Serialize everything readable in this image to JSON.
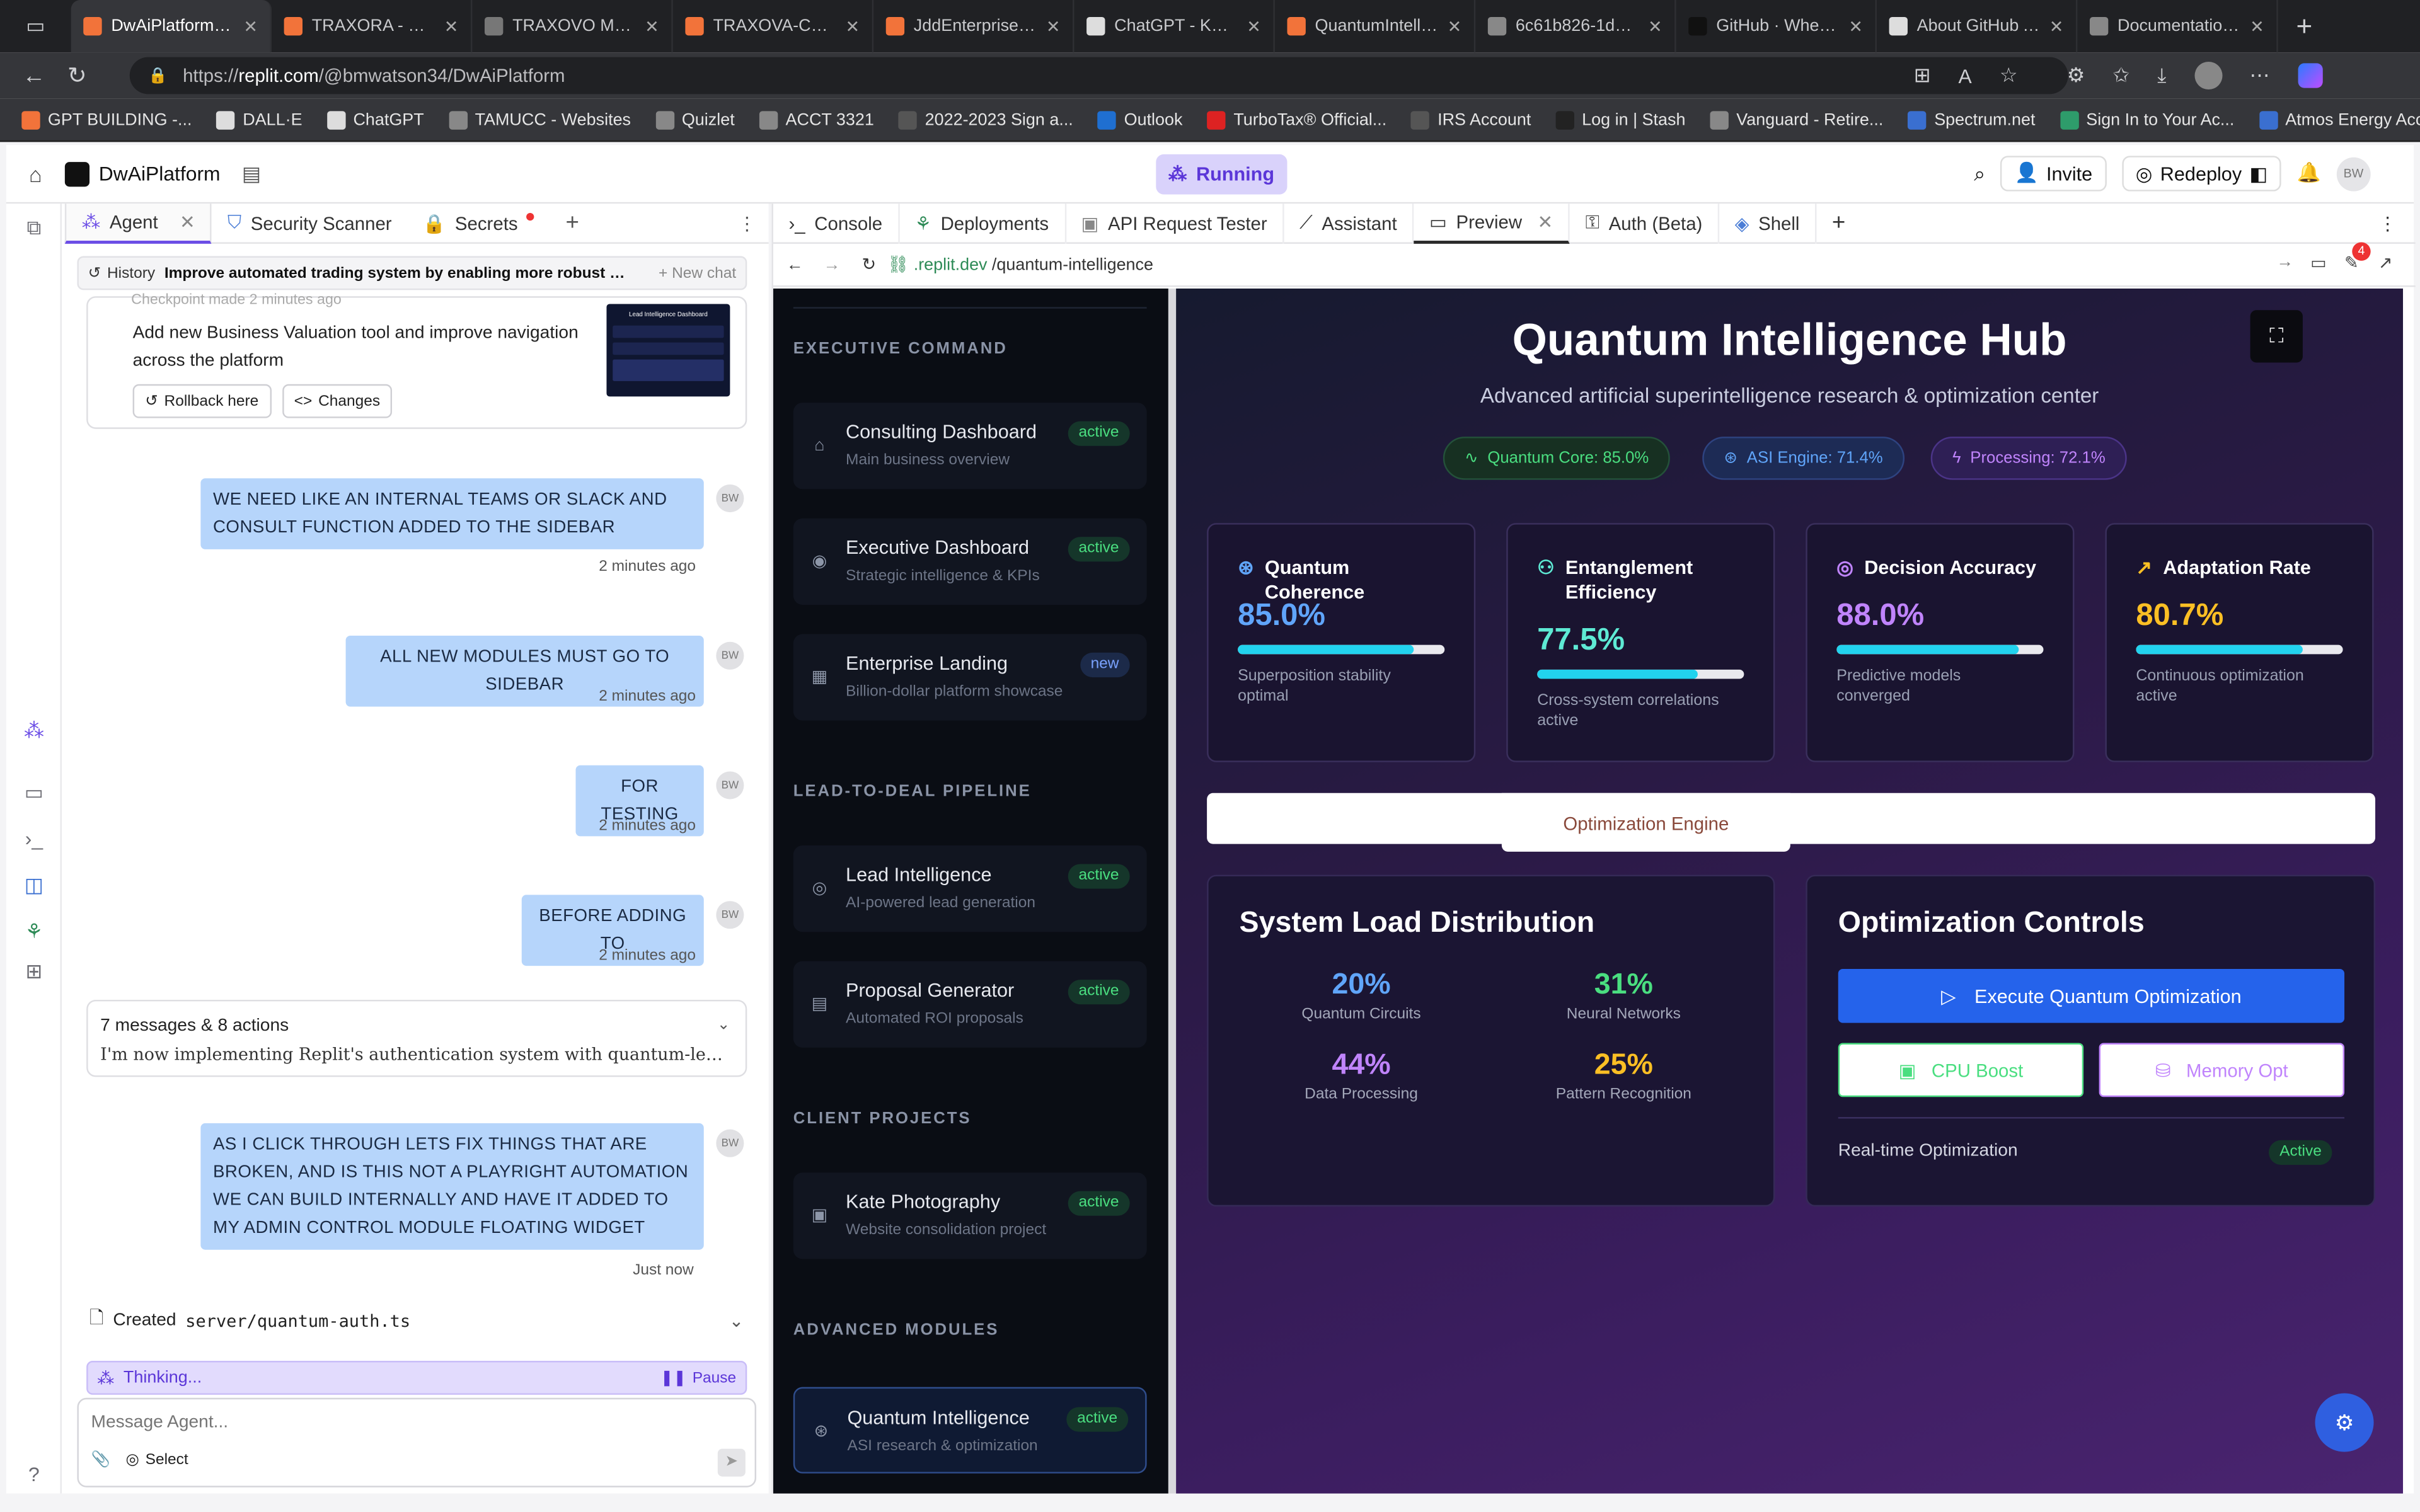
{
  "browser": {
    "tabs": [
      {
        "label": "DwAiPlatform - Re",
        "active": true
      },
      {
        "label": "TRAXORA - Replit"
      },
      {
        "label": "TRAXOVO Master"
      },
      {
        "label": "TRAXOVA-COMPL"
      },
      {
        "label": "JddEnterprisesAu"
      },
      {
        "label": "ChatGPT - Kaizen"
      },
      {
        "label": "QuantumIntelliger"
      },
      {
        "label": "6c61b826-1d0e-4"
      },
      {
        "label": "GitHub · Where sc"
      },
      {
        "label": "About GitHub Adv"
      },
      {
        "label": "Documentation fo"
      }
    ],
    "url_prefix": "https://",
    "url_host": "replit.com",
    "url_path": "/@bmwatson34/DwAiPlatform",
    "bookmarks": [
      "GPT BUILDING -...",
      "DALL·E",
      "ChatGPT",
      "TAMUCC - Websites",
      "Quizlet",
      "ACCT 3321",
      "2022-2023 Sign a...",
      "Outlook",
      "TurboTax® Official...",
      "IRS Account",
      "Log in | Stash",
      "Vanguard - Retire...",
      "Spectrum.net",
      "Sign In to Your Ac...",
      "Atmos Energy Acc..."
    ]
  },
  "replit": {
    "repl_name": "DwAiPlatform",
    "run_status": "Running",
    "invite_label": "Invite",
    "redeploy_label": "Redeploy",
    "avatar_initials": "BW"
  },
  "left_tabs": [
    "Agent",
    "Security Scanner",
    "Secrets"
  ],
  "agent": {
    "history_label": "History",
    "current_task": "Improve automated trading system by enabling more robust liv...",
    "new_chat_label": "+ New chat",
    "checkpoint_text": "Checkpoint made 2 minutes ago",
    "checkpoint_desc": "Add new Business Valuation tool and improve navigation across the platform",
    "rollback_label": "Rollback here",
    "changes_label": "Changes",
    "thumb_title": "Lead Intelligence Dashboard",
    "messages": [
      {
        "text": "WE NEED LIKE AN INTERNAL TEAMS OR SLACK AND CONSULT FUNCTION ADDED TO THE SIDEBAR",
        "time": "2 minutes ago"
      },
      {
        "text": "ALL NEW MODULES MUST GO TO SIDEBAR",
        "time": "2 minutes ago"
      },
      {
        "text": "FOR TESTING",
        "time": "2 minutes ago"
      },
      {
        "text": "BEFORE ADDING TO",
        "time": "2 minutes ago"
      },
      {
        "text": "AS I CLICK THROUGH LETS FIX THINGS THAT ARE BROKEN, AND IS THIS NOT A PLAYRIGHT AUTOMATION WE CAN BUILD INTERNALLY AND HAVE IT ADDED TO MY ADMIN CONTROL MODULE FLOATING WIDGET",
        "time": "Just now"
      }
    ],
    "actions_summary": "7 messages & 8 actions",
    "actions_detail": "I'm now implementing Replit's authentication system with quantum-level sec...",
    "created_prefix": "Created",
    "created_file": "server/quantum-auth.ts",
    "thinking_label": "Thinking...",
    "pause_label": "Pause",
    "input_placeholder": "Message Agent...",
    "select_label": "Select"
  },
  "right_tabs": [
    "Console",
    "Deployments",
    "API Request Tester",
    "Assistant",
    "Preview",
    "Auth (Beta)",
    "Shell"
  ],
  "preview_url_host": ".replit.dev",
  "preview_url_path": "/quantum-intelligence",
  "notification_count": "4",
  "sidebar": {
    "sections": [
      {
        "title": "EXECUTIVE COMMAND",
        "items": [
          {
            "title": "Consulting Dashboard",
            "sub": "Main business overview",
            "badge": "active",
            "icon": "home-icon"
          },
          {
            "title": "Executive Dashboard",
            "sub": "Strategic intelligence & KPIs",
            "badge": "active",
            "icon": "eye-icon"
          },
          {
            "title": "Enterprise Landing",
            "sub": "Billion-dollar platform showcase",
            "badge": "new",
            "icon": "building-icon"
          }
        ]
      },
      {
        "title": "LEAD-TO-DEAL PIPELINE",
        "items": [
          {
            "title": "Lead Intelligence",
            "sub": "AI-powered lead generation",
            "badge": "active",
            "icon": "target-icon"
          },
          {
            "title": "Proposal Generator",
            "sub": "Automated ROI proposals",
            "badge": "active",
            "icon": "document-icon"
          }
        ]
      },
      {
        "title": "CLIENT PROJECTS",
        "items": [
          {
            "title": "Kate Photography",
            "sub": "Website consolidation project",
            "badge": "active",
            "icon": "camera-icon"
          }
        ]
      },
      {
        "title": "ADVANCED MODULES",
        "items": [
          {
            "title": "Quantum Intelligence",
            "sub": "ASI research & optimization",
            "badge": "active",
            "icon": "brain-icon"
          }
        ]
      }
    ]
  },
  "hub": {
    "title": "Quantum Intelligence Hub",
    "subtitle": "Advanced artificial superintelligence research & optimization center",
    "pills": [
      {
        "label": "Quantum Core: 85.0%",
        "color": "#4ade80"
      },
      {
        "label": "ASI Engine: 71.4%",
        "color": "#60a5fa"
      },
      {
        "label": "Processing: 72.1%",
        "color": "#c084fc"
      }
    ],
    "metrics": [
      {
        "title": "Quantum Coherence",
        "value": "85.0%",
        "fill": 0.85,
        "desc": "Superposition stability optimal",
        "color": "#60a5fa"
      },
      {
        "title": "Entanglement Efficiency",
        "value": "77.5%",
        "fill": 0.775,
        "desc": "Cross-system correlations active",
        "color": "#5eead4"
      },
      {
        "title": "Decision Accuracy",
        "value": "88.0%",
        "fill": 0.88,
        "desc": "Predictive models converged",
        "color": "#c084fc"
      },
      {
        "title": "Adaptation Rate",
        "value": "80.7%",
        "fill": 0.807,
        "desc": "Continuous optimization active",
        "color": "#fbbf24"
      }
    ],
    "tab_label": "Optimization Engine",
    "load_title": "System Load Distribution",
    "load": [
      {
        "value": "20%",
        "label": "Quantum Circuits",
        "color": "#60a5fa"
      },
      {
        "value": "31%",
        "label": "Neural Networks",
        "color": "#4ade80"
      },
      {
        "value": "44%",
        "label": "Data Processing",
        "color": "#c084fc"
      },
      {
        "value": "25%",
        "label": "Pattern Recognition",
        "color": "#fbbf24"
      }
    ],
    "controls_title": "Optimization Controls",
    "execute_label": "Execute Quantum Optimization",
    "cpu_label": "CPU Boost",
    "memory_label": "Memory Opt",
    "realtime_label": "Real-time Optimization",
    "realtime_status": "Active"
  }
}
